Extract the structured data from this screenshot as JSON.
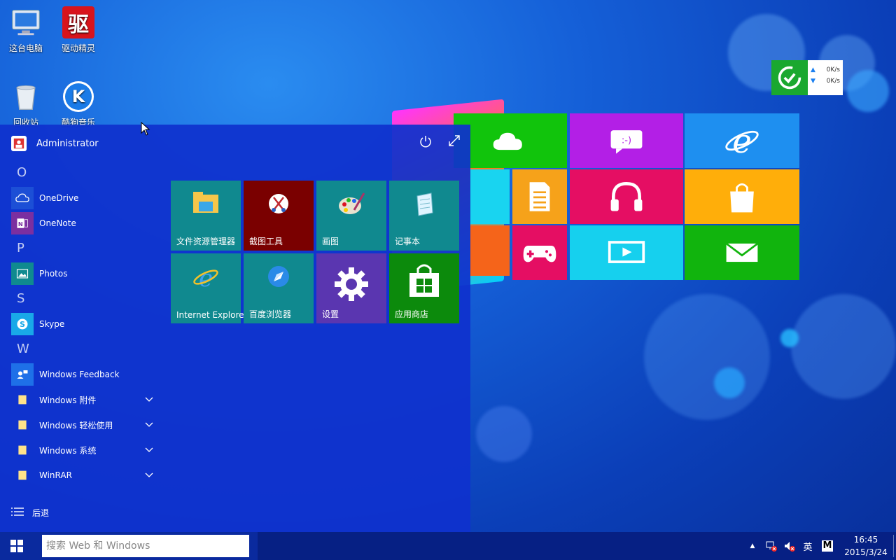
{
  "desktop_icons": [
    {
      "label": "这台电脑",
      "icon": "computer-icon"
    },
    {
      "label": "驱动精灵",
      "icon": "driver-genius-icon",
      "glyph": "驱"
    },
    {
      "label": "回收站",
      "icon": "recycle-bin-icon"
    },
    {
      "label": "酷狗音乐",
      "icon": "kugou-icon",
      "glyph": "K"
    }
  ],
  "network_widget": {
    "up": "0K/s",
    "down": "0K/s"
  },
  "start_menu": {
    "user": "Administrator",
    "letters": {
      "o": "O",
      "p": "P",
      "s": "S",
      "w": "W"
    },
    "apps": [
      {
        "label": "OneDrive"
      },
      {
        "label": "OneNote"
      },
      {
        "label": "Photos"
      },
      {
        "label": "Skype"
      },
      {
        "label": "Windows Feedback"
      },
      {
        "label": "Windows 附件"
      },
      {
        "label": "Windows 轻松使用"
      },
      {
        "label": "Windows 系统"
      },
      {
        "label": "WinRAR"
      }
    ],
    "back": "后退",
    "tiles": [
      {
        "label": "文件资源管理器",
        "color": "#10898f"
      },
      {
        "label": "截图工具",
        "color": "#7a0000"
      },
      {
        "label": "画图",
        "color": "#10898f"
      },
      {
        "label": "记事本",
        "color": "#10898f"
      },
      {
        "label": "Internet Explore",
        "color": "#10898f"
      },
      {
        "label": "百度浏览器",
        "color": "#10898f"
      },
      {
        "label": "设置",
        "color": "#5a36b0"
      },
      {
        "label": "应用商店",
        "color": "#0c8a0c"
      }
    ]
  },
  "taskbar": {
    "search_placeholder": "搜索 Web 和 Windows",
    "ime": "英",
    "ime_mode": "M",
    "time": "16:45",
    "date": "2015/3/24"
  },
  "colors": {
    "accent": "#0f32cd",
    "taskbar": "#0a2a9e"
  }
}
